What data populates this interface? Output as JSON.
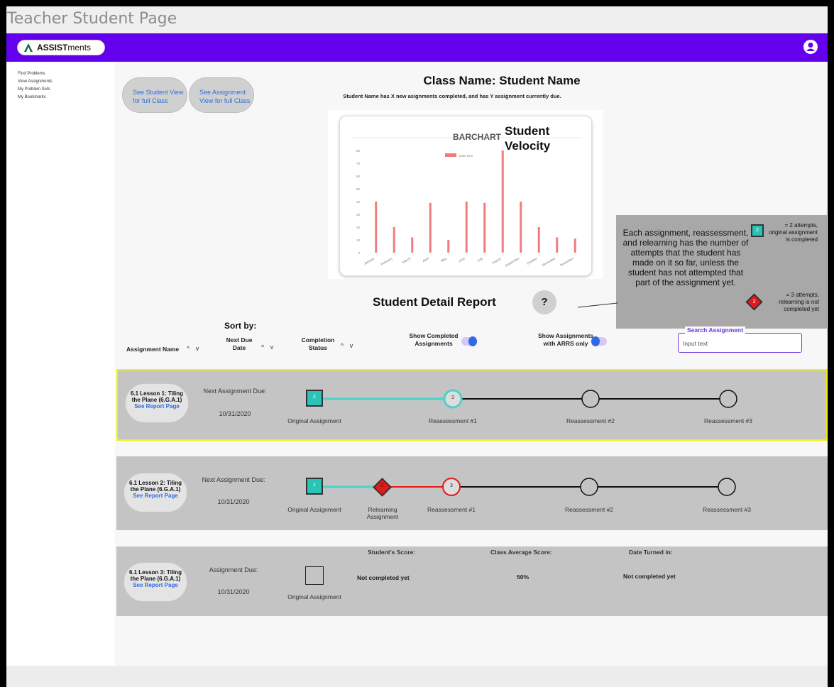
{
  "page_title": "Teacher Student Page",
  "logo": {
    "brand_bold": "ASSIST",
    "brand_rest": "ments"
  },
  "sidebar": {
    "items": [
      "Find Problems",
      "View Assignments",
      "My Problem Sets",
      "My Bookmarks"
    ]
  },
  "buttons": {
    "student_view": "See Student View for full Class",
    "assignment_view": "See Assignment View for full Class"
  },
  "header": {
    "class_title": "Class Name: Student Name",
    "summary": "Student Name has X new asignments completed, and has Y assignment currently due."
  },
  "chart_title": "BARCHART",
  "chart_overlay_title": "Student Velocity",
  "chart_data": {
    "type": "bar",
    "title": "BARCHART",
    "legend": [
      "Data One"
    ],
    "categories": [
      "January",
      "February",
      "March",
      "April",
      "May",
      "June",
      "July",
      "August",
      "September",
      "October",
      "November",
      "December"
    ],
    "series": [
      {
        "name": "Data One",
        "values": [
          40,
          20,
          12,
          39,
          10,
          40,
          39,
          80,
          40,
          20,
          12,
          11
        ]
      }
    ],
    "yticks": [
      0,
      10,
      20,
      30,
      40,
      50,
      60,
      70,
      80
    ],
    "ylim": [
      0,
      80
    ],
    "color": "#ef7d7d"
  },
  "legend": {
    "description": "Each assignment, reassessment, and relearning  has the number of attempts that the student has made on it so far, unless the student has not attempted that part of the assignment yet.",
    "square_num": "2",
    "square_text": "= 2 attempts, original assignment is completed",
    "diamond_num": "3",
    "diamond_text": "= 3 attempts, relearning is not completed yet"
  },
  "detail_title": "Student Detail Report",
  "help_label": "?",
  "sort": {
    "label": "Sort by:",
    "assignment_name": "Assignment Name",
    "next_due": "Next Due Date",
    "completion": "Completion Status",
    "show_completed": "Show Completed Assignments",
    "show_arrs": "Show Assignments with ARRS only",
    "search_label": "Search Assignment",
    "search_value": "Input text"
  },
  "rows": [
    {
      "name": "6.1 Lesson 1: Tiling the Plane (6.G.A.1)",
      "link": "See Report Page",
      "due_label": "Next Assignment Due:",
      "due_date": "10/31/2020",
      "nodes": [
        {
          "label": "Original Assignment",
          "value": "2"
        },
        {
          "label": "Reassessment #1",
          "value": "3"
        },
        {
          "label": "Reassessment #2",
          "value": ""
        },
        {
          "label": "Reassessment #3",
          "value": ""
        }
      ]
    },
    {
      "name": "6.1 Lesson 2: Tiling the Plane (6.G.A.1)",
      "link": "See Report Page",
      "due_label": "Next Assignment Due:",
      "due_date": "10/31/2020",
      "nodes": [
        {
          "label": "Original Assignment",
          "value": "1"
        },
        {
          "label": "Relearning Assignment",
          "value": "3"
        },
        {
          "label": "Reassessment #1",
          "value": "3"
        },
        {
          "label": "Reassessment #2",
          "value": ""
        },
        {
          "label": "Reassessment #3",
          "value": ""
        }
      ]
    },
    {
      "name": "6.1 Lesson 3: Tiling the Plane (6.G.A.1)",
      "link": "See Report Page",
      "due_label": "Assignment Due:",
      "due_date": "10/31/2020",
      "node_label": "Original Assignment",
      "student_score_h": "Student's Score:",
      "student_score": "Not completed yet",
      "class_avg_h": "Class Average Score:",
      "class_avg": "50%",
      "turned_in_h": "Date Turned in:",
      "turned_in": "Not completed yet"
    }
  ],
  "colors": {
    "purple": "#6400ee",
    "teal": "#2ac4b7",
    "red": "#e21a1a",
    "highlight": "#f2f20a"
  }
}
